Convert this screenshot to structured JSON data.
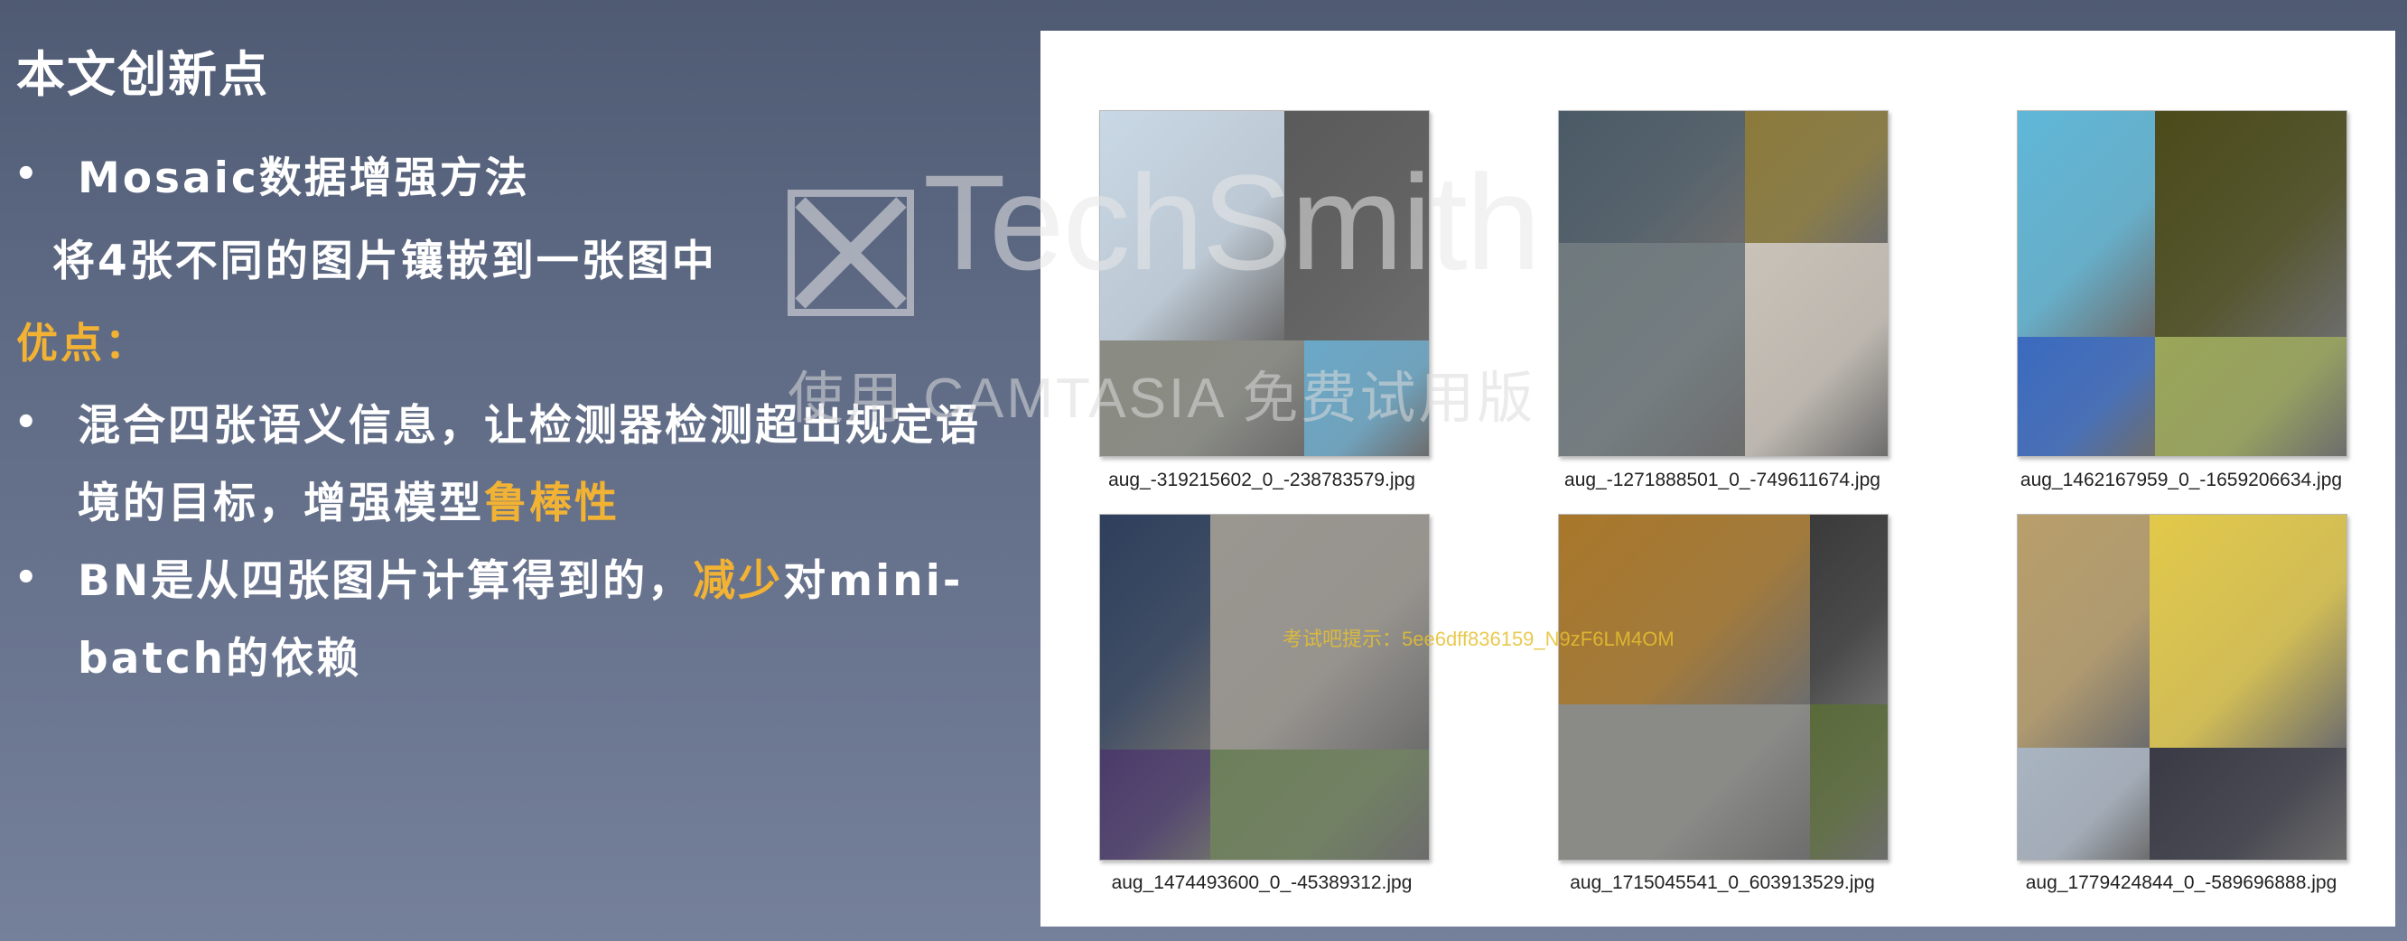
{
  "slide": {
    "title": "本文创新点",
    "bullet1_title": "Mosaic数据增强方法",
    "bullet1_desc": "将4张不同的图片镶嵌到一张图中",
    "advantages_label": "优点：",
    "adv1_part1": "混合四张语义信息，让检测器检测超出规定语",
    "adv1_part2": "境的目标，增强模型",
    "adv1_highlight": "鲁棒性",
    "adv2_part1": "BN是从四张图片计算得到的，",
    "adv2_highlight": "减少",
    "adv2_part2": "对mini-",
    "adv2_part3": "batch的依赖",
    "bullet_char": "•"
  },
  "images": [
    {
      "caption": "aug_-319215602_0_-238783579.jpg",
      "colors": [
        "#c9d8e6",
        "#5a5a5a",
        "#8a8c84",
        "#6aa8c8"
      ]
    },
    {
      "caption": "aug_-1271888501_0_-749611674.jpg",
      "colors": [
        "#4a5a66",
        "#8b7a3a",
        "#6f7a7e",
        "#c9c2b8"
      ]
    },
    {
      "caption": "aug_1462167959_0_-1659206634.jpg",
      "colors": [
        "#5fb7d8",
        "#4a4a1a",
        "#3a6ac0",
        "#9aa658"
      ]
    },
    {
      "caption": "aug_1474493600_0_-45389312.jpg",
      "colors": [
        "#2e3f5c",
        "#9a9690",
        "#4a3a6a",
        "#6c7f5a"
      ]
    },
    {
      "caption": "aug_1715045541_0_603913529.jpg",
      "colors": [
        "#a8772a",
        "#3a3a3a",
        "#8a8a86",
        "#5a6a3a"
      ]
    },
    {
      "caption": "aug_1779424844_0_-589696888.jpg",
      "colors": [
        "#b89e6a",
        "#e2c94a",
        "#a9b4c2",
        "#3a3a46"
      ]
    }
  ],
  "watermark": {
    "brand": "TechSmith",
    "product": "使用 CAMTASIA 免费试用版",
    "id_text": "考试吧提示：5ee6dff836159_N9zF6LM4OM"
  }
}
